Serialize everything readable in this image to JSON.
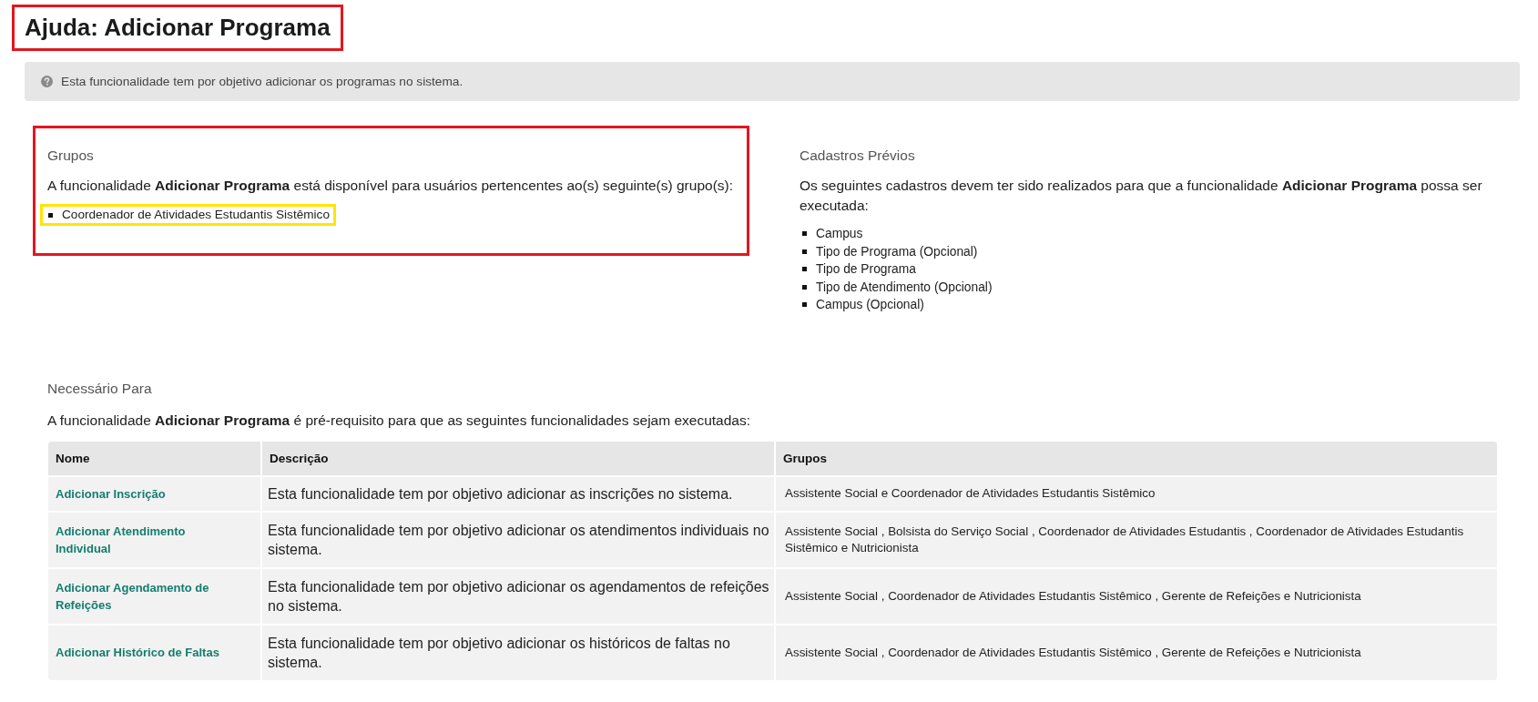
{
  "header": {
    "title": "Ajuda: Adicionar Programa",
    "highlighted": true
  },
  "info": {
    "text": "Esta funcionalidade tem por objetivo adicionar os programas no sistema."
  },
  "groups_section": {
    "heading": "Grupos",
    "text": "A funcionalidade **Adicionar Programa** está disponível para usuários pertencentes ao(s) seguinte(s) grupo(s):",
    "highlighted": true,
    "items": [
      {
        "label": "Coordenador de Atividades Estudantis Sistêmico",
        "highlighted": true
      }
    ]
  },
  "prerequisites_section": {
    "heading": "Cadastros Prévios",
    "text": "Os seguintes cadastros devem ter sido realizados para que a funcionalidade **Adicionar Programa** possa ser executada:",
    "items": [
      "Campus",
      "Tipo de Programa (Opcional)",
      "Tipo de Programa",
      "Tipo de Atendimento (Opcional)",
      "Campus (Opcional)"
    ]
  },
  "required_for_section": {
    "heading": "Necessário Para",
    "text": "A funcionalidade **Adicionar Programa** é pré-requisito para que as seguintes funcionalidades sejam executadas:",
    "table": {
      "columns": [
        "Nome",
        "Descrição",
        "Grupos"
      ],
      "rows": [
        {
          "name": "Adicionar Inscrição",
          "description": "Esta funcionalidade tem por objetivo adicionar as inscrições no sistema.",
          "groups": "Assistente Social e Coordenador de Atividades Estudantis Sistêmico"
        },
        {
          "name": "Adicionar Atendimento Individual",
          "description": "Esta funcionalidade tem por objetivo adicionar os atendimentos individuais no sistema.",
          "groups": "Assistente Social , Bolsista do Serviço Social , Coordenador de Atividades Estudantis , Coordenador de Atividades Estudantis Sistêmico e Nutricionista"
        },
        {
          "name": "Adicionar Agendamento de Refeições",
          "description": "Esta funcionalidade tem por objetivo adicionar os agendamentos de refeições no sistema.",
          "groups": "Assistente Social , Coordenador de Atividades Estudantis Sistêmico , Gerente de Refeições e Nutricionista"
        },
        {
          "name": "Adicionar Histórico de Faltas",
          "description": "Esta funcionalidade tem por objetivo adicionar os históricos de faltas no sistema.",
          "groups": "Assistente Social , Coordenador de Atividades Estudantis Sistêmico , Gerente de Refeições e Nutricionista"
        }
      ]
    }
  }
}
